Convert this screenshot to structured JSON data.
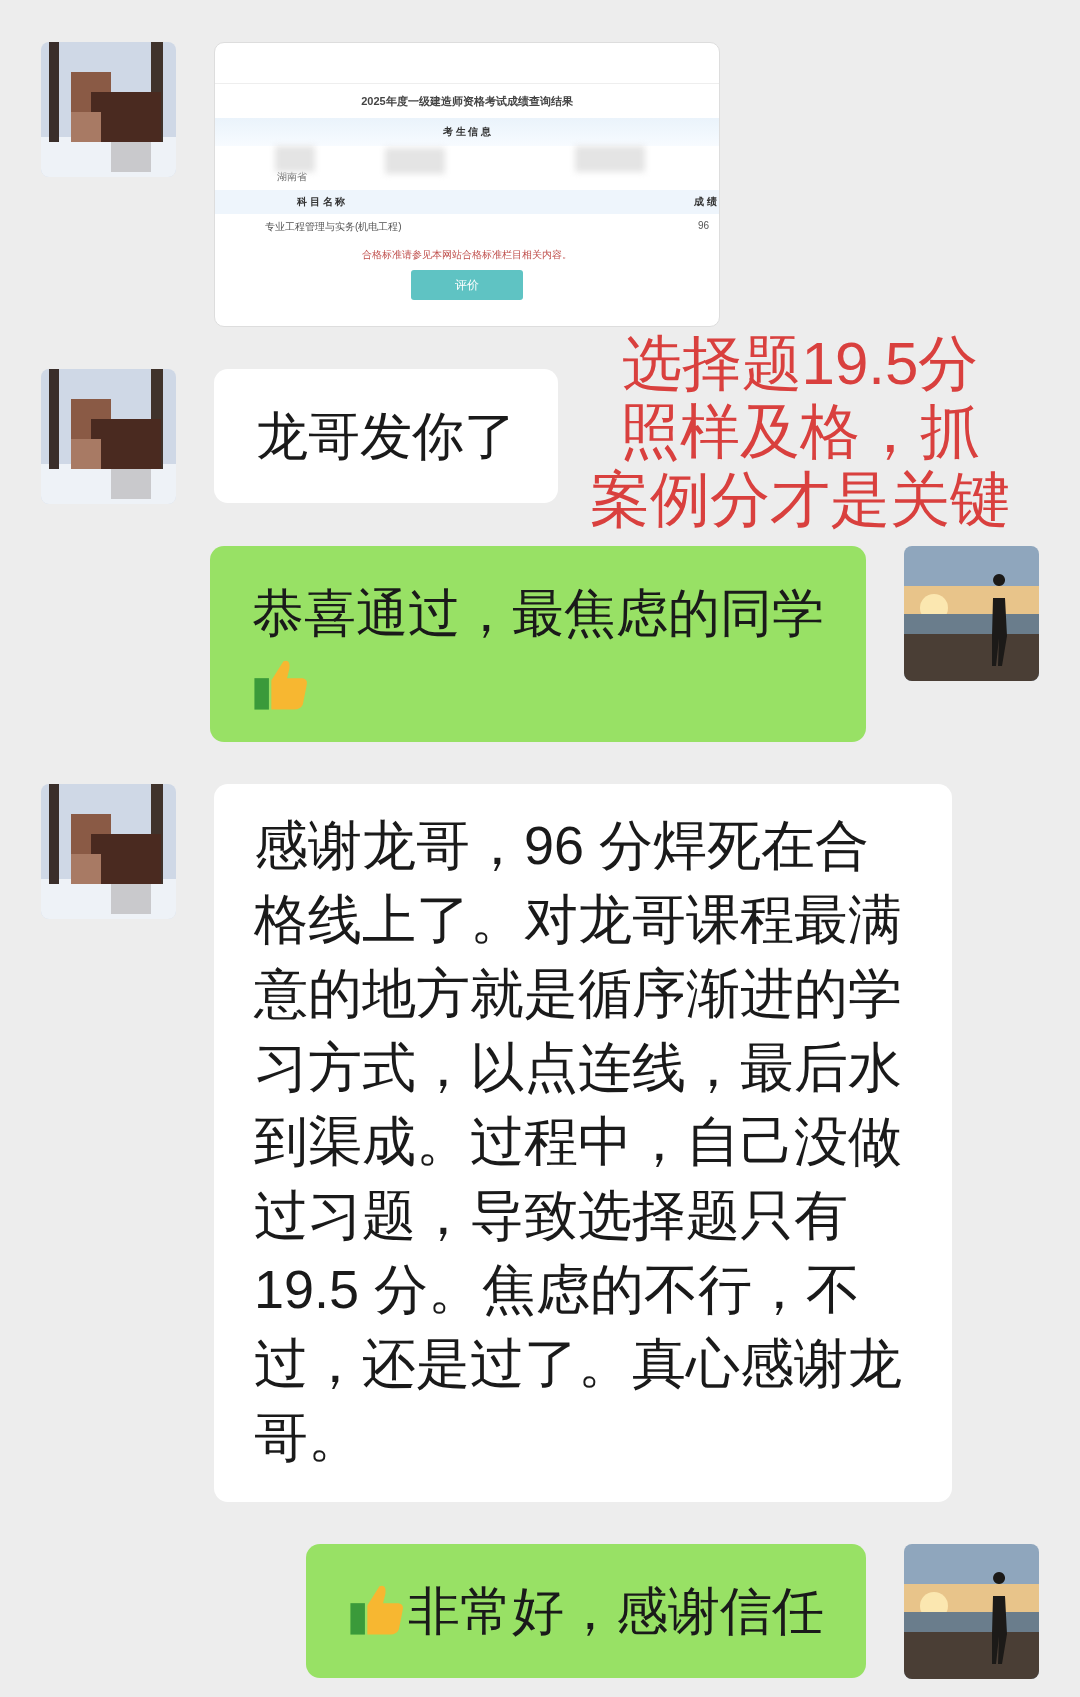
{
  "messages": [
    {
      "outgoing": false,
      "card": {
        "title": "2025年度一级建造师资格考试成绩查询结果",
        "section": "考 生 信 息",
        "province": "湖南省",
        "columns": [
          "科 目 名 称",
          "成 绩"
        ],
        "rows": [
          {
            "subject": "专业工程管理与实务(机电工程)",
            "score": "96"
          }
        ],
        "note": "合格标准请参见本网站合格标准栏目相关内容。",
        "button": "评价"
      }
    },
    {
      "kind": "text",
      "outgoing": false,
      "text": "龙哥发你了"
    },
    {
      "kind": "text",
      "outgoing": true,
      "text": "恭喜通过，最焦虑的同学",
      "emoji_after": true
    },
    {
      "kind": "text",
      "outgoing": false,
      "text": "感谢龙哥，96 分焊死在合格线上了。对龙哥课程最满意的地方就是循序渐进的学习方式，以点连线，最后水到渠成。过程中，自己没做过习题，导致选择题只有19.5 分。焦虑的不行，不过，还是过了。真心感谢龙哥。"
    },
    {
      "kind": "text",
      "outgoing": true,
      "text": "非常好，感谢信任",
      "emoji_before": true
    }
  ],
  "overlay": {
    "lines": [
      "选择题19.5分",
      "照样及格，抓",
      "案例分才是关键"
    ]
  }
}
